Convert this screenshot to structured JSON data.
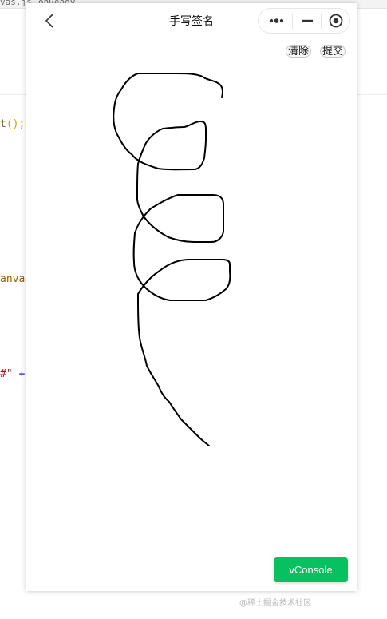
{
  "editor": {
    "tab_left": "vas.js",
    "tab_right": "onReady",
    "code_line_1_fn": "t",
    "code_line_1_rest": "();",
    "code_line_2": "anva",
    "code_line_3_str": "#\"",
    "code_line_3_op": "+"
  },
  "navbar": {
    "title": "手写签名",
    "back_icon": "chevron-left-icon",
    "capsule": {
      "more_icon": "more-dots-icon",
      "minimize_icon": "minimize-icon",
      "close_icon": "target-circle-icon"
    }
  },
  "actions": {
    "clear_label": "清除",
    "submit_label": "提交"
  },
  "signature": {
    "stroke_color": "#000000",
    "description_icon": "handwritten-stroke"
  },
  "vconsole": {
    "label": "vConsole",
    "color": "#07c160"
  },
  "watermark": {
    "text": "@稀土掘金技术社区"
  }
}
